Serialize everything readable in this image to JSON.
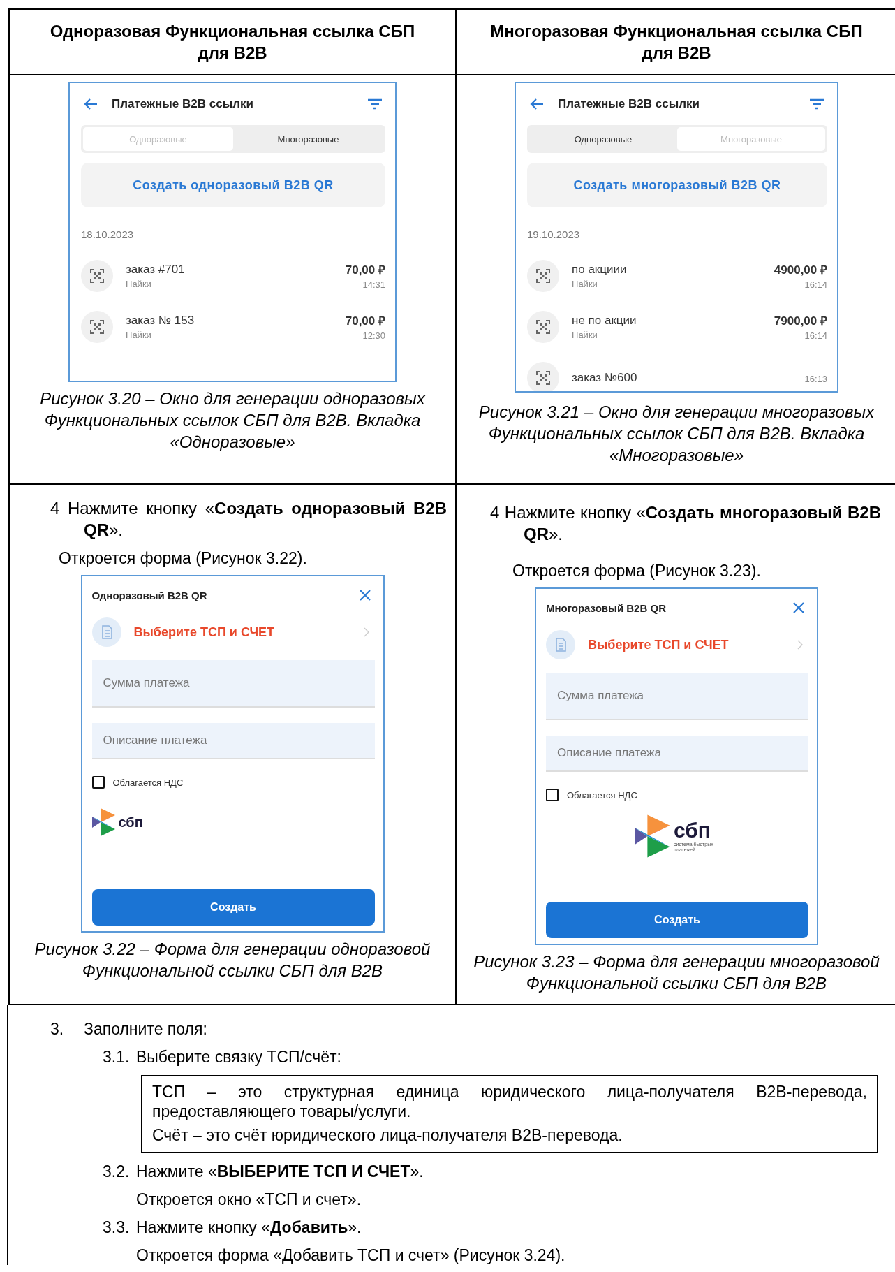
{
  "table": {
    "columns": [
      {
        "heading": "Одноразовая Функциональная ссылка СБП для B2B",
        "list_screen": {
          "title": "Платежные B2B ссылки",
          "tabs": [
            {
              "label": "Одноразовые",
              "selected": true
            },
            {
              "label": "Многоразовые",
              "selected": false
            }
          ],
          "create_button": "Создать одноразовый B2B QR",
          "date": "18.10.2023",
          "rows": [
            {
              "title": "заказ #701",
              "subtitle": "Найки",
              "amount": "70,00 ₽",
              "time": "14:31"
            },
            {
              "title": "заказ № 153",
              "subtitle": "Найки",
              "amount": "70,00 ₽",
              "time": "12:30"
            }
          ]
        },
        "list_caption": "Рисунок 3.20 – Окно для генерации одноразовых Функциональных ссылок СБП для B2B. Вкладка «Одноразовые»",
        "step": "4 Нажмите кнопку «**Создать одноразовый B2B QR**».",
        "step_note": "Откроется форма (Рисунок 3.22).",
        "form_screen": {
          "title": "Одноразовый B2B QR",
          "select_label": "Выберите ТСП и СЧЕТ",
          "fields": [
            {
              "placeholder": "Сумма платежа"
            },
            {
              "placeholder": "Описание платежа"
            }
          ],
          "vat_checkbox": {
            "label": "Облагается НДС",
            "checked": false
          },
          "logo": {
            "kind": "compact",
            "text": "сбп"
          },
          "submit": "Создать"
        },
        "form_caption": "Рисунок 3.22 – Форма для генерации одноразовой Функциональной ссылки СБП для B2B"
      },
      {
        "heading": "Многоразовая Функциональная ссылка СБП для B2B",
        "list_screen": {
          "title": "Платежные B2B ссылки",
          "tabs": [
            {
              "label": "Одноразовые",
              "selected": false
            },
            {
              "label": "Многоразовые",
              "selected": true
            }
          ],
          "create_button": "Создать многоразовый B2B QR",
          "date": "19.10.2023",
          "rows": [
            {
              "title": "по акциии",
              "subtitle": "Найки",
              "amount": "4900,00 ₽",
              "time": "16:14"
            },
            {
              "title": "не по акции",
              "subtitle": "Найки",
              "amount": "7900,00 ₽",
              "time": "16:14"
            },
            {
              "title": "заказ №600",
              "time": "16:13"
            }
          ]
        },
        "list_caption": "Рисунок 3.21 – Окно для генерации многоразовых Функциональных ссылок СБП для B2B. Вкладка «Многоразовые»",
        "step": "4 Нажмите кнопку «**Создать многоразовый B2B QR**».",
        "step_note": "Откроется форма (Рисунок 3.23).",
        "form_screen": {
          "title": "Многоразовый B2B QR",
          "select_label": "Выберите ТСП и СЧЕТ",
          "fields": [
            {
              "placeholder": "Сумма платежа"
            },
            {
              "placeholder": "Описание платежа"
            }
          ],
          "vat_checkbox": {
            "label": "Облагается НДС",
            "checked": false
          },
          "logo": {
            "kind": "full",
            "text": "сбп",
            "tagline": "система быстрых платежей"
          },
          "submit": "Создать"
        },
        "form_caption": "Рисунок 3.23 – Форма для генерации многоразовой Функциональной ссылки СБП для B2B"
      }
    ]
  },
  "instructions": [
    {
      "kind": "item",
      "number": "3.",
      "text": "Заполните поля:"
    },
    {
      "kind": "subitem",
      "number": "3.1.",
      "text": "Выберите связку ТСП/счёт:"
    },
    {
      "kind": "note",
      "paragraphs": [
        "ТСП – это структурная единица юридического лица-получателя B2B-перевода, предоставляющего товары/услуги.",
        "Счёт – это счёт юридического лица-получателя B2B-перевода."
      ]
    },
    {
      "kind": "subitem",
      "number": "3.2.",
      "text": "Нажмите «**ВЫБЕРИТЕ ТСП И СЧЕТ**»."
    },
    {
      "kind": "subtext",
      "text": "Откроется окно «ТСП и счет»."
    },
    {
      "kind": "subitem",
      "number": "3.3.",
      "text": "Нажмите кнопку «**Добавить**»."
    },
    {
      "kind": "subtext",
      "text": "Откроется форма «Добавить ТСП и счет» (Рисунок 3.24)."
    }
  ]
}
